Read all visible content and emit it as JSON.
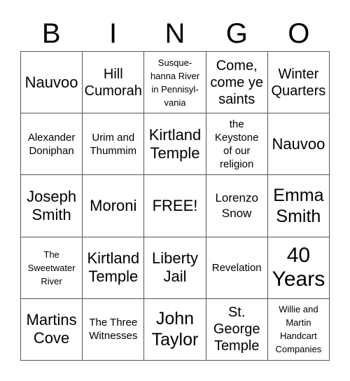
{
  "header": {
    "letters": [
      "B",
      "I",
      "N",
      "G",
      "O"
    ]
  },
  "cells": [
    {
      "text": "Nauvoo"
    },
    {
      "text": "Hill\nCumorah"
    },
    {
      "text": "Susque-\nhanna River\nin Pennisyl-\nvania"
    },
    {
      "text": "Come,\ncome ye\nsaints"
    },
    {
      "text": "Winter\nQuarters"
    },
    {
      "text": "Alexander\nDoniphan"
    },
    {
      "text": "Urim and\nThummim"
    },
    {
      "text": "Kirtland\nTemple"
    },
    {
      "text": "the\nKeystone\nof our\nreligion"
    },
    {
      "text": "Nauvoo"
    },
    {
      "text": "Joseph\nSmith"
    },
    {
      "text": "Moroni"
    },
    {
      "text": "FREE!"
    },
    {
      "text": "Lorenzo\nSnow"
    },
    {
      "text": "Emma\nSmith"
    },
    {
      "text": "The\nSweetwater\nRiver"
    },
    {
      "text": "Kirtland\nTemple"
    },
    {
      "text": "Liberty\nJail"
    },
    {
      "text": "Revelation"
    },
    {
      "text": "40\nYears"
    },
    {
      "text": "Martins\nCove"
    },
    {
      "text": "The Three\nWitnesses"
    },
    {
      "text": "John\nTaylor"
    },
    {
      "text": "St.\nGeorge\nTemple"
    },
    {
      "text": "Willie and\nMartin\nHandcart\nCompanies"
    }
  ]
}
